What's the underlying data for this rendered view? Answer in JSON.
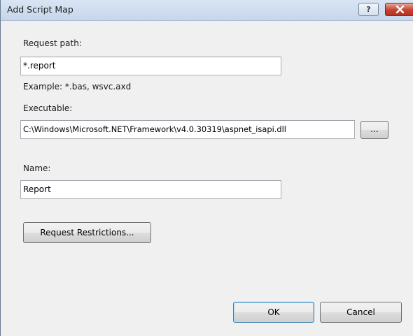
{
  "window": {
    "title": "Add Script Map",
    "help_glyph": "?",
    "close_icon": "close-icon"
  },
  "request_path": {
    "label": "Request path:",
    "value": "*.report",
    "example": "Example: *.bas, wsvc.axd"
  },
  "executable": {
    "label": "Executable:",
    "value": "C:\\Windows\\Microsoft.NET\\Framework\\v4.0.30319\\aspnet_isapi.dll",
    "browse_label": "..."
  },
  "name": {
    "label": "Name:",
    "value": "Report"
  },
  "buttons": {
    "request_restrictions": "Request Restrictions...",
    "ok": "OK",
    "cancel": "Cancel"
  },
  "colors": {
    "titlebar": "#c6d6ea",
    "close_button": "#c7402f",
    "dialog_background": "#f0f0f0",
    "default_button_border": "#3c7fb1"
  }
}
